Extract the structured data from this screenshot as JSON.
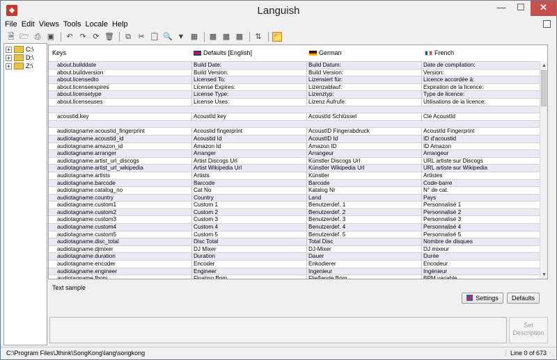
{
  "window": {
    "title": "Languish"
  },
  "menu": [
    {
      "label": "File"
    },
    {
      "label": "Edit"
    },
    {
      "label": "Views"
    },
    {
      "label": "Tools"
    },
    {
      "label": "Locale"
    },
    {
      "label": "Help"
    }
  ],
  "tree": [
    {
      "label": "C:\\"
    },
    {
      "label": "D:\\"
    },
    {
      "label": "Z:\\"
    }
  ],
  "table": {
    "headers": {
      "keys": "Keys",
      "defaults": "Defaults [English]",
      "german": "German",
      "french": "French"
    },
    "rows": [
      [
        "about.builddate",
        "Build Date:",
        "Build Datum:",
        "Date de compilation:"
      ],
      [
        "about.buildversion",
        "Build Version:",
        "Build Version:",
        "Version:"
      ],
      [
        "about.licensedto",
        "Licensed To:",
        "Lizensiert für:",
        "Licence accordée à:"
      ],
      [
        "about.licenseexpires",
        "License Expires:",
        "Lizenzablauf:",
        "Expiration de la licence:"
      ],
      [
        "about.licensetype",
        "License Type:",
        "Lizenztyp:",
        "Type de licence:"
      ],
      [
        "about.licenseuses",
        "License Uses:",
        "Lizenz Aufrufe:",
        "Utilisations de la licence:"
      ],
      [
        "",
        "",
        "",
        ""
      ],
      [
        "acoustid.key",
        "AcoustId key",
        "AcoustId Schlüssel",
        "Clé AcoustId"
      ],
      [
        "",
        "",
        "",
        ""
      ],
      [
        "audiotagname.acoustid_fingerprint",
        "Acoustid fingerprint",
        "AcoustID Fingerabdruck",
        "AcoustId Fingerprint"
      ],
      [
        "audiotagname.acoustid_id",
        "Acoustid Id",
        "AcoustID Id",
        "ID d'acoustid"
      ],
      [
        "audiotagname.amazon_id",
        "Amazon Id",
        "Amazon ID",
        "ID Amazon"
      ],
      [
        "audiotagname.arranger",
        "Arranger",
        "Arrangeur",
        "Arrangeur"
      ],
      [
        "audiotagname.artist_url_discogs",
        "Artist Discogs Url",
        "Künstler Discogs Url",
        "URL artiste sur Discogs"
      ],
      [
        "audiotagname.artist_url_wikipedia",
        "Artist Wikipedia Url",
        "Künstler Wikipedia Url",
        "URL artiste sur Wikipedia"
      ],
      [
        "audiotagname.artists",
        "Artists",
        "Künstler",
        "Artistes"
      ],
      [
        "audiotagname.barcode",
        "Barcode",
        "Barcode",
        "Code-barre"
      ],
      [
        "audiotagname.catalog_no",
        "Cat No",
        "Katalog Nr",
        "N° de cat."
      ],
      [
        "audiotagname.country",
        "Country",
        "Land",
        "Pays"
      ],
      [
        "audiotagname.custom1",
        "Custom 1",
        "Benutzerdef. 1",
        "Personnalisé 1"
      ],
      [
        "audiotagname.custom2",
        "Custom 2",
        "Benutzerdef. 2",
        "Personnalisé 2"
      ],
      [
        "audiotagname.custom3",
        "Custom 3",
        "Benutzerdef. 3",
        "Personnalisé 3"
      ],
      [
        "audiotagname.custom4",
        "Custom 4",
        "Benutzerdef. 4",
        "Personnalisé 4"
      ],
      [
        "audiotagname.custom5",
        "Custom 5",
        "Benutzerdef. 5",
        "Personnalisé 5"
      ],
      [
        "audiotagname.disc_total",
        "Disc Total",
        "Total Disc",
        "Nombre de disques"
      ],
      [
        "audiotagname.djmixer",
        "DJ Mixer",
        "DJ-Mixer",
        "DJ mixeur"
      ],
      [
        "audiotagname.duration",
        "Duration",
        "Dauer",
        "Durée"
      ],
      [
        "audiotagname.encoder",
        "Encoder",
        "Enkodierer",
        "Encodeur"
      ],
      [
        "audiotagname.engineer",
        "Engineer",
        "Ingenieur",
        "Ingénieur"
      ],
      [
        "audiotagname.fbpm",
        "Floating Bpm",
        "Fließende Bpm",
        "BPM variable"
      ]
    ]
  },
  "sample": {
    "label": "Text sample"
  },
  "buttons": {
    "settings": "Settings",
    "defaults": "Defaults",
    "set_description_1": "Set",
    "set_description_2": "Description"
  },
  "status": {
    "path": "C:\\Program Files\\Jthink\\SongKong\\lang\\songkong",
    "line": "Line 0 of 673"
  }
}
